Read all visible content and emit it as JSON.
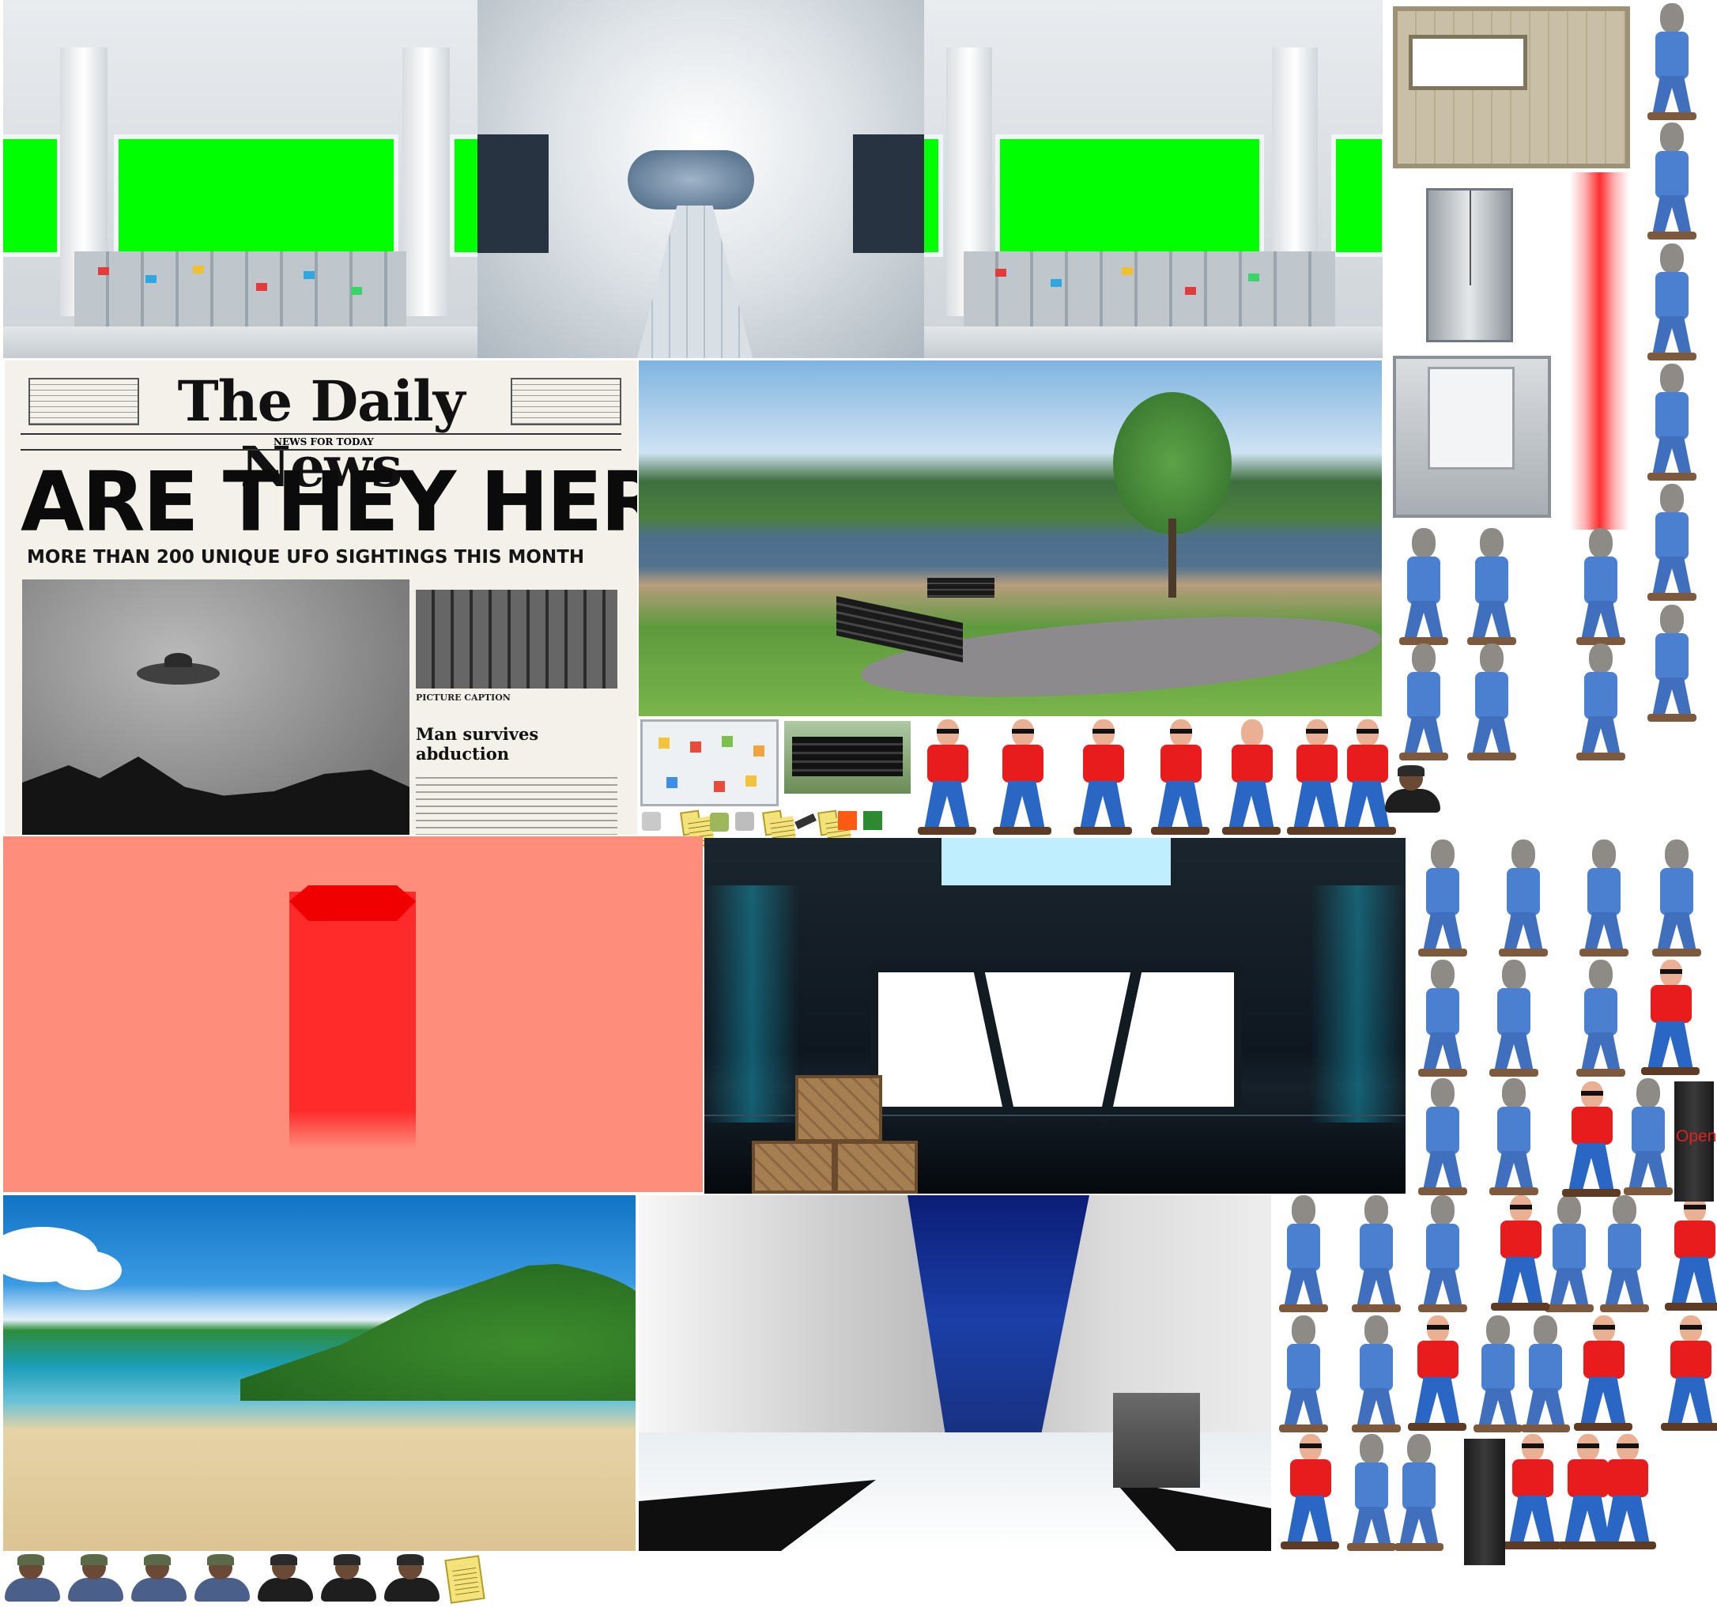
{
  "atlas": {
    "newspaper": {
      "masthead": "The Daily News",
      "headline": "ARE THEY HERE ?",
      "subheadline": "MORE THAN 200 UNIQUE UFO SIGHTINGS THIS MONTH",
      "tagline": "NEWS FOR TODAY",
      "photo_caption": "PICTURE CAPTION",
      "story_title": "Man survives abduction"
    },
    "cabinet_label": "Open",
    "sprite_icons": {
      "alien": "alien-walk-icon",
      "man": "red-shirt-man-icon",
      "hacker": "hacker-headset-icon",
      "note": "sticky-note-icon"
    },
    "colors": {
      "greenscreen": "#00ff00",
      "red_room": "#ff8d7b",
      "laser": "#ff2d2d",
      "alien_shirt": "#4b7fd0",
      "man_shirt": "#e81c1c"
    }
  }
}
